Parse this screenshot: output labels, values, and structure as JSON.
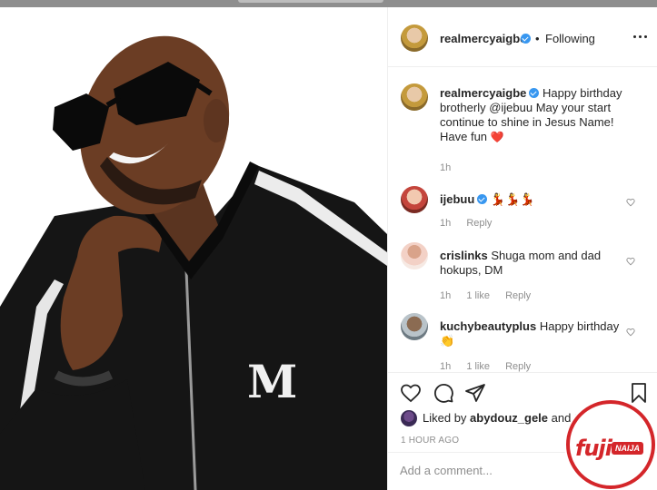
{
  "post": {
    "author": "realmercyaigbe",
    "separator": "•",
    "follow_status": "Following"
  },
  "comments": [
    {
      "username": "realmercyaigbe",
      "text": "Happy birthday brotherly @ijebuu May your start continue to shine in Jesus Name! Have fun",
      "emoji": "❤️",
      "time": "1h"
    },
    {
      "username": "ijebuu",
      "text": "💃💃💃",
      "time": "1h",
      "reply": "Reply"
    },
    {
      "username": "crislinks",
      "text": "Shuga mom and dad hokups, DM",
      "time": "1h",
      "likes": "1 like",
      "reply": "Reply"
    },
    {
      "username": "kuchybeautyplus",
      "text": "Happy birthday",
      "emoji": "👏",
      "time": "1h",
      "likes": "1 like",
      "reply": "Reply"
    }
  ],
  "liked_by": {
    "prefix": "Liked by",
    "user": "abydouz_gele",
    "suffix": "and 3,0"
  },
  "timestamp": "1 HOUR AGO",
  "add_comment": {
    "placeholder": "Add a comment..."
  },
  "watermark": {
    "brand": "fuji",
    "tag": "NAIJA"
  },
  "colors": {
    "accent": "#3897f0",
    "heart": "#ed4956",
    "watermark": "#d4262a",
    "muted": "#8e8e8e"
  }
}
